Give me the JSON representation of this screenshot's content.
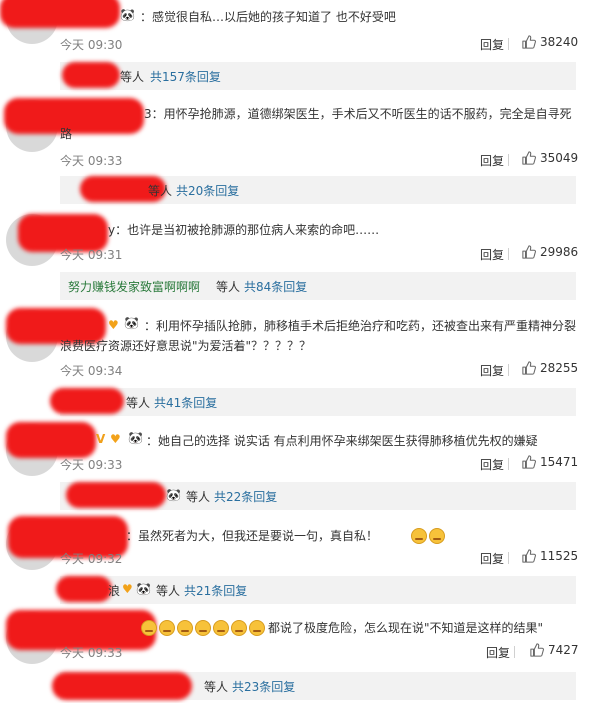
{
  "ui": {
    "reply_label": "回复",
    "users_suffix": "等人",
    "panda_icon": "🐼"
  },
  "comments": [
    {
      "text": "：感觉很自私…以后她的孩子知道了 也不好受吧",
      "time": "今天 09:30",
      "likes": "38240",
      "subreplies": {
        "user": "",
        "suffix": "等人",
        "count": "共157条回复"
      }
    },
    {
      "text": "3：用怀孕抢肺源，道德绑架医生，手术后又不听医生的话不服药，完全是自寻死路",
      "time": "今天 09:33",
      "likes": "35049",
      "subreplies": {
        "user": "",
        "suffix": "等人",
        "count": "共20条回复"
      }
    },
    {
      "text": "y：也许是当初被抢肺源的那位病人来索的命吧……",
      "time": "今天 09:31",
      "likes": "29986",
      "subreplies": {
        "user": "努力赚钱发家致富啊啊啊",
        "suffix": "等人",
        "count": "共84条回复"
      }
    },
    {
      "text": "：利用怀孕插队抢肺，肺移植手术后拒绝治疗和吃药，还被查出来有严重精神分裂 浪费医疗资源还好意思说\"为爱活着\"？？？？？",
      "time": "今天 09:34",
      "likes": "28255",
      "subreplies": {
        "user": "",
        "suffix": "等人",
        "count": "共41条回复"
      }
    },
    {
      "text": "：她自己的选择 说实话 有点利用怀孕来绑架医生获得肺移植优先权的嫌疑",
      "time": "今天 09:33",
      "likes": "15471",
      "subreplies": {
        "user": "",
        "suffix": "等人",
        "count": "共22条回复"
      }
    },
    {
      "text": "：虽然死者为大，但我还是要说一句，真自私！",
      "time": "今天 09:32",
      "likes": "11525",
      "subreplies": {
        "user": "浪",
        "suffix": "等人",
        "count": "共21条回复"
      }
    },
    {
      "text": "都说了极度危险，怎么现在说\"不知道是这样的结果\"",
      "time": "今天 09:33",
      "likes": "7427",
      "subreplies": {
        "user": "",
        "suffix": "等人",
        "count": "共23条回复"
      }
    }
  ],
  "colors": {
    "redaction": "#f01a1a",
    "subbar_bg": "#f2f2f2",
    "link_blue": "#2a6f9f",
    "time_gray": "#808080"
  }
}
